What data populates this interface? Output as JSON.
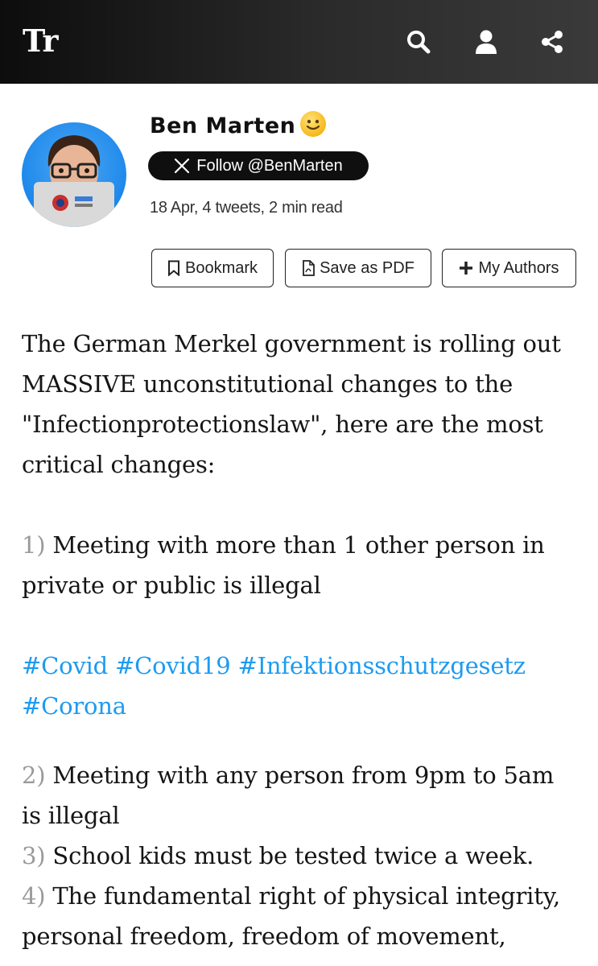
{
  "topbar": {
    "logo": "Tr",
    "icons": [
      "search-icon",
      "user-icon",
      "share-icon"
    ]
  },
  "author": {
    "name": "Ben Marten",
    "emoji": "slightly-smiling-face",
    "follow_label": "Follow @BenMarten",
    "meta": "18 Apr, 4 tweets, 2 min read"
  },
  "actions": {
    "bookmark": "Bookmark",
    "save_pdf": "Save as PDF",
    "my_authors": "My Authors"
  },
  "thread": {
    "intro": "The German Merkel government is rolling out MASSIVE unconstitutional changes to the \"Infectionprotectionslaw\", here are the most critical changes:",
    "item1_num": "1)",
    "item1_text": "Meeting with more than 1 other person in private or public is illegal",
    "hashtags_line1": "#Covid #Covid19 #Infektionsschutzgesetz",
    "hashtags_line2": "#Corona",
    "item2_num": "2)",
    "item2_text": "Meeting with any person from 9pm to 5am is illegal",
    "item3_num": "3)",
    "item3_text": "School kids must be tested twice a week.",
    "item4_num": "4)",
    "item4_text": "The fundamental right of physical integrity, personal freedom, freedom of movement,"
  },
  "colors": {
    "topbar": "#1a1a1a",
    "hashtag": "#1d9bf0",
    "number": "#9a9a9a",
    "avatar_bg": "#1d87ea"
  }
}
